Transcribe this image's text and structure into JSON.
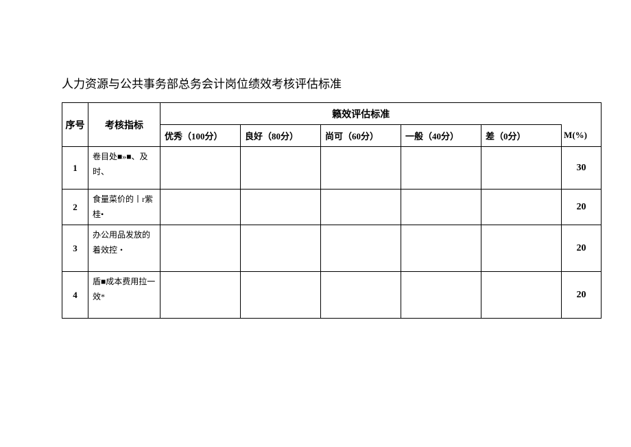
{
  "title": "人力资源与公共事务部总务会计岗位绩效考核评估标准",
  "headers": {
    "seq": "序号",
    "indicator": "考核指标",
    "group": "籁效评估标准",
    "ratings": {
      "excellent_pre": "优秀（",
      "excellent_num": "100",
      "excellent_post": "分）",
      "good_pre": "良好（",
      "good_num": "80",
      "good_post": "分）",
      "fair_pre": "尚可（",
      "fair_num": "60",
      "fair_post": "分）",
      "avg_pre": "一般（",
      "avg_num": "40",
      "avg_post": "分）",
      "poor_pre": "差（",
      "poor_num": "0",
      "poor_post": "分）"
    },
    "weight": "M(%)"
  },
  "rows": [
    {
      "seq": "1",
      "indicator": "卷目处■»■、及时、",
      "weight": "30"
    },
    {
      "seq": "2",
      "indicator": "食量菜价的丨r紫桂•",
      "weight": "20"
    },
    {
      "seq": "3",
      "indicator": "办公用品发放的着效控・",
      "weight": "20"
    },
    {
      "seq": "4",
      "indicator": "盾■成本费用拉一效*",
      "weight": "20"
    }
  ]
}
